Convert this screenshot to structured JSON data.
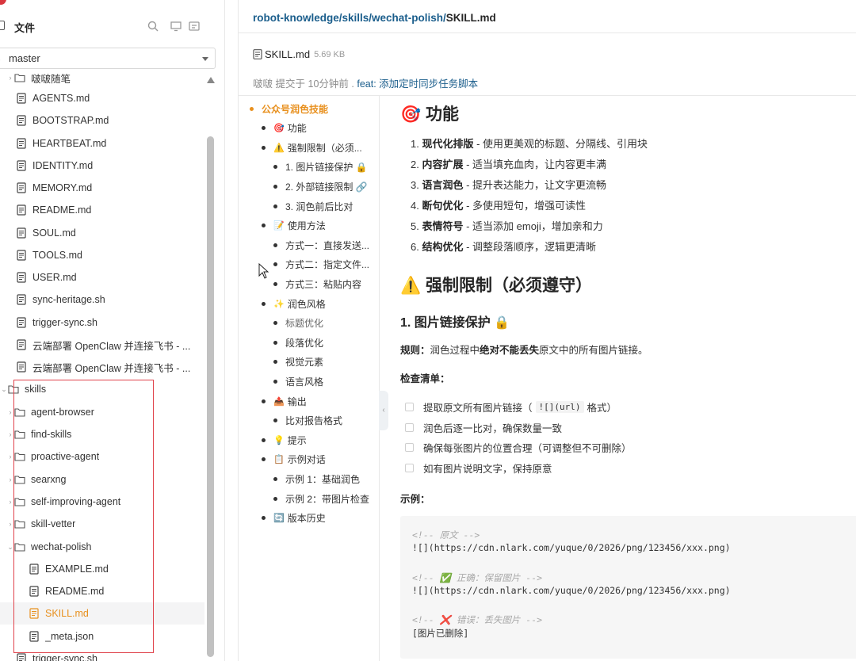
{
  "files_panel": {
    "title": "文件",
    "branch": "master",
    "tree": [
      {
        "label": "啵啵随笔",
        "type": "folder"
      },
      {
        "label": "AGENTS.md",
        "type": "file"
      },
      {
        "label": "BOOTSTRAP.md",
        "type": "file"
      },
      {
        "label": "HEARTBEAT.md",
        "type": "file"
      },
      {
        "label": "IDENTITY.md",
        "type": "file"
      },
      {
        "label": "MEMORY.md",
        "type": "file"
      },
      {
        "label": "README.md",
        "type": "file"
      },
      {
        "label": "SOUL.md",
        "type": "file"
      },
      {
        "label": "TOOLS.md",
        "type": "file"
      },
      {
        "label": "USER.md",
        "type": "file"
      },
      {
        "label": "sync-heritage.sh",
        "type": "file"
      },
      {
        "label": "trigger-sync.sh",
        "type": "file"
      },
      {
        "label": "云端部署 OpenClaw 并连接飞书 - ...",
        "type": "file"
      },
      {
        "label": "云端部署 OpenClaw 并连接飞书 - ...",
        "type": "file"
      },
      {
        "label": "skills",
        "type": "folder-open"
      },
      {
        "label": "agent-browser",
        "type": "folder"
      },
      {
        "label": "find-skills",
        "type": "folder"
      },
      {
        "label": "proactive-agent",
        "type": "folder"
      },
      {
        "label": "searxng",
        "type": "folder"
      },
      {
        "label": "self-improving-agent",
        "type": "folder"
      },
      {
        "label": "skill-vetter",
        "type": "folder"
      },
      {
        "label": "wechat-polish",
        "type": "folder-open"
      },
      {
        "label": "EXAMPLE.md",
        "type": "file"
      },
      {
        "label": "README.md",
        "type": "file"
      },
      {
        "label": "SKILL.md",
        "type": "file",
        "active": true
      },
      {
        "label": "_meta.json",
        "type": "file"
      },
      {
        "label": "trigger-sync.sh",
        "type": "file"
      }
    ]
  },
  "breadcrumb": {
    "path": "robot-knowledge/skills/wechat-polish/",
    "current": "SKILL.md"
  },
  "file_info": {
    "name": "SKILL.md",
    "size": "5.69 KB",
    "author": "啵啵",
    "committed_text": "提交于",
    "time": "10分钟前",
    "sep": ".",
    "commit_message": "feat: 添加定时同步任务脚本"
  },
  "outline": [
    {
      "text": "公众号润色技能",
      "emoji": "",
      "level": 0
    },
    {
      "text": "功能",
      "emoji": "🎯",
      "level": 1
    },
    {
      "text": "强制限制（必须...",
      "emoji": "⚠️",
      "level": 1
    },
    {
      "text": "1. 图片链接保护 🔒",
      "emoji": "",
      "level": 2
    },
    {
      "text": "2. 外部链接限制 🔗",
      "emoji": "",
      "level": 2
    },
    {
      "text": "3. 润色前后比对",
      "emoji": "",
      "level": 2
    },
    {
      "text": "使用方法",
      "emoji": "📝",
      "level": 1
    },
    {
      "text": "方式一：直接发送...",
      "emoji": "",
      "level": 2
    },
    {
      "text": "方式二：指定文件...",
      "emoji": "",
      "level": 2
    },
    {
      "text": "方式三：粘贴内容",
      "emoji": "",
      "level": 2
    },
    {
      "text": "润色风格",
      "emoji": "✨",
      "level": 1
    },
    {
      "text": "标题优化",
      "emoji": "",
      "level": 2,
      "muted": true
    },
    {
      "text": "段落优化",
      "emoji": "",
      "level": 2
    },
    {
      "text": "视觉元素",
      "emoji": "",
      "level": 2
    },
    {
      "text": "语言风格",
      "emoji": "",
      "level": 2
    },
    {
      "text": "输出",
      "emoji": "📤",
      "level": 1
    },
    {
      "text": "比对报告格式",
      "emoji": "",
      "level": 2
    },
    {
      "text": "提示",
      "emoji": "💡",
      "level": 1
    },
    {
      "text": "示例对话",
      "emoji": "📋",
      "level": 1
    },
    {
      "text": "示例 1：基础润色",
      "emoji": "",
      "level": 2
    },
    {
      "text": "示例 2：带图片检查",
      "emoji": "",
      "level": 2
    },
    {
      "text": "版本历史",
      "emoji": "🔄",
      "level": 1
    }
  ],
  "article": {
    "features_heading": "🎯 功能",
    "features": [
      {
        "num": "1.",
        "bold": "现代化排版",
        "rest": " - 使用更美观的标题、分隔线、引用块"
      },
      {
        "num": "2.",
        "bold": "内容扩展",
        "rest": " - 适当填充血肉，让内容更丰满"
      },
      {
        "num": "3.",
        "bold": "语言润色",
        "rest": " - 提升表达能力，让文字更流畅"
      },
      {
        "num": "4.",
        "bold": "断句优化",
        "rest": " - 多使用短句，增强可读性"
      },
      {
        "num": "5.",
        "bold": "表情符号",
        "rest": " - 适当添加 emoji，增加亲和力"
      },
      {
        "num": "6.",
        "bold": "结构优化",
        "rest": " - 调整段落顺序，逻辑更清晰"
      }
    ],
    "limits_heading": "⚠️ 强制限制（必须遵守）",
    "sub_heading": "1. 图片链接保护 🔒",
    "rule_label": "规则：",
    "rule_pre": "润色过程中",
    "rule_bold": "绝对不能丢失",
    "rule_post": "原文中的所有图片链接。",
    "checklist_label": "检查清单：",
    "checklist": [
      {
        "pre": "提取原文所有图片链接（",
        "code": "![](url)",
        "post": "格式）"
      },
      {
        "pre": "润色后逐一比对，确保数量一致",
        "code": "",
        "post": ""
      },
      {
        "pre": "确保每张图片的位置合理（可调整但不可删除）",
        "code": "",
        "post": ""
      },
      {
        "pre": "如有图片说明文字，保持原意",
        "code": "",
        "post": ""
      }
    ],
    "example_label": "示例：",
    "code_lines": [
      {
        "text": "<!-- 原文 -->",
        "kind": "comment"
      },
      {
        "text": "![](https://cdn.nlark.com/yuque/0/2026/png/123456/xxx.png)",
        "kind": "text"
      },
      {
        "text": "<!-- ✅ 正确：保留图片 -->",
        "kind": "comment"
      },
      {
        "text": "![](https://cdn.nlark.com/yuque/0/2026/png/123456/xxx.png)",
        "kind": "text"
      },
      {
        "text": "<!-- ❌ 错误：丢失图片 -->",
        "kind": "comment"
      },
      {
        "text": "[图片已删除]",
        "kind": "text"
      }
    ]
  }
}
